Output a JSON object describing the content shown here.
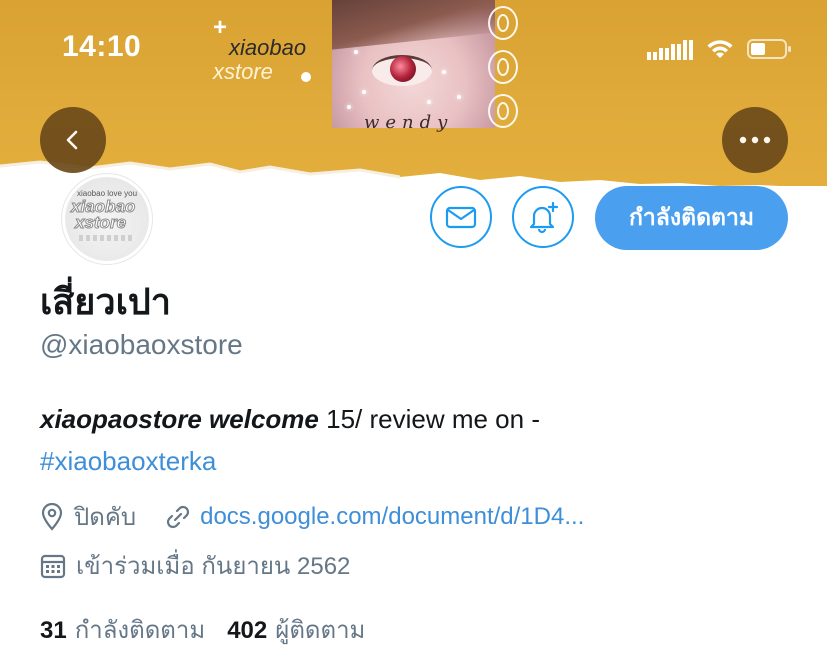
{
  "status_bar": {
    "time": "14:10"
  },
  "banner": {
    "watermark_plus": "+",
    "watermark_line1": "xiaobao",
    "watermark_line2": "xstore",
    "signature": "wendy",
    "background_color": "#dfaa3a"
  },
  "avatar": {
    "small_text": "xiaobao love you",
    "line1": "xiaobao",
    "line2": "xstore"
  },
  "actions": {
    "back_icon": "chevron-left-icon",
    "more_icon": "ellipsis-icon",
    "mail_icon": "mail-icon",
    "notify_icon": "bell-plus-icon",
    "follow_label": "กำลังติดตาม"
  },
  "profile": {
    "name": "เสี่ยวเปา",
    "handle": "@xiaobaoxstore",
    "bio_bold": "xiaopaostore welcome",
    "bio_rest": " 15/ review me on -",
    "bio_hashtag": "#xiaobaoxterka",
    "location": "ปิดคับ",
    "link": "docs.google.com/document/d/1D4...",
    "joined": "เข้าร่วมเมื่อ กันยายน 2562",
    "following_count": "31",
    "following_label": "กำลังติดตาม",
    "followers_count": "402",
    "followers_label": "ผู้ติดตาม"
  },
  "colors": {
    "accent": "#1d9bf0",
    "follow_button": "#4a9fef",
    "link": "#3f8ed8",
    "secondary_text": "#657786"
  }
}
